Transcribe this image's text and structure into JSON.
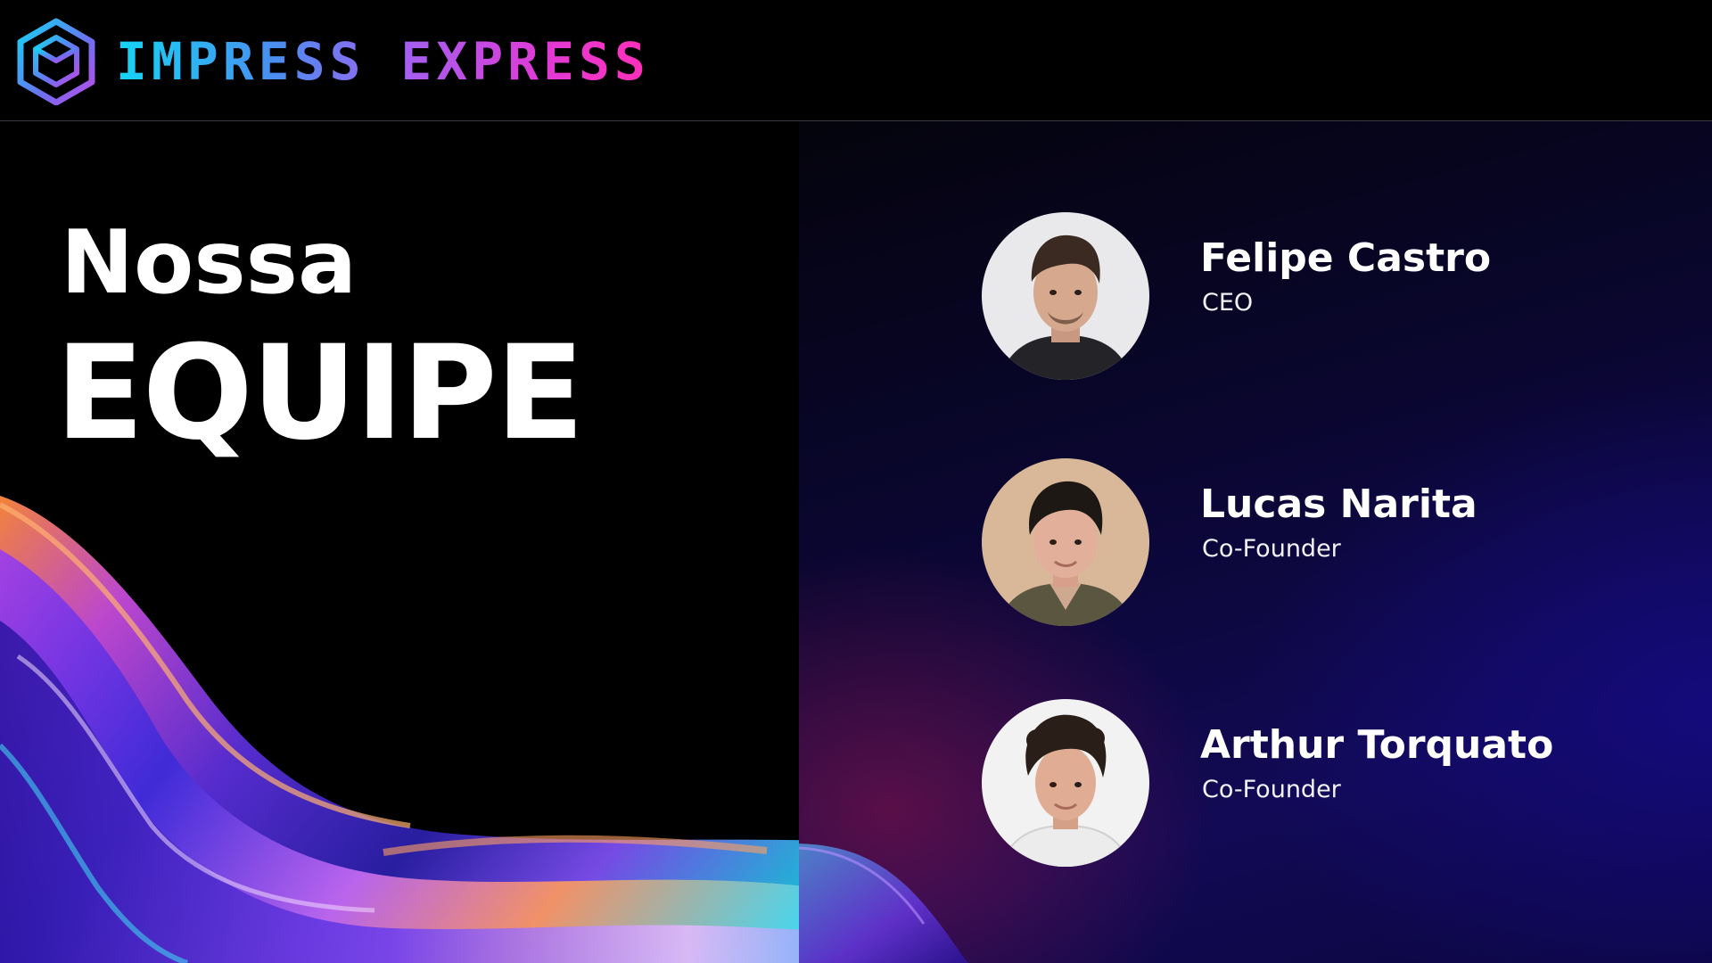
{
  "header": {
    "brand": "IMPRESS EXPRESS",
    "logo_icon": "cube-logo-icon"
  },
  "hero": {
    "title_small": "Nossa",
    "title_big": "EQUIPE"
  },
  "team": [
    {
      "name": "Felipe Castro",
      "role": "CEO",
      "avatar_icon": "person-photo-icon"
    },
    {
      "name": "Lucas Narita",
      "role": "Co-Founder",
      "avatar_icon": "person-photo-icon"
    },
    {
      "name": "Arthur Torquato",
      "role": "Co-Founder",
      "avatar_icon": "person-photo-icon"
    }
  ],
  "colors": {
    "background": "#000000",
    "brand_cyan": "#14d6f5",
    "brand_magenta": "#ff2fb8",
    "panel_purple": "#120a55",
    "text": "#ffffff"
  }
}
